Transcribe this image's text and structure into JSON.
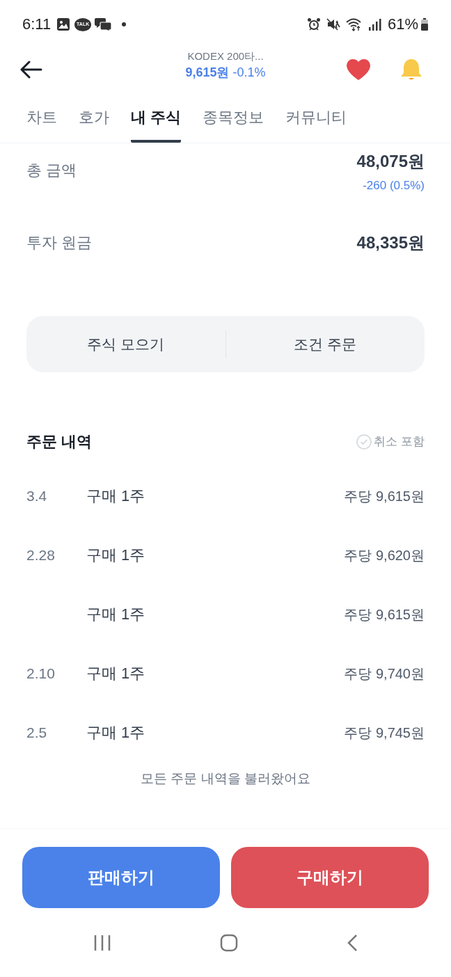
{
  "status_bar": {
    "time": "6:11",
    "chat_badge": "TALK",
    "battery": "61%"
  },
  "header": {
    "title": "KODEX 200타...",
    "price": "9,615원",
    "change": "-0.1%",
    "favorite": true,
    "alert_on": true
  },
  "tabs": [
    {
      "label": "차트",
      "selected": false
    },
    {
      "label": "호가",
      "selected": false
    },
    {
      "label": "내 주식",
      "selected": true
    },
    {
      "label": "종목정보",
      "selected": false
    },
    {
      "label": "커뮤니티",
      "selected": false
    }
  ],
  "summary": [
    {
      "label": "총 금액",
      "value": "48,075원",
      "change": "-260 (0.5%)"
    },
    {
      "label": "투자 원금",
      "value": "48,335원"
    }
  ],
  "actions": [
    "주식 모으기",
    "조건 주문"
  ],
  "orders": {
    "title": "주문 내역",
    "filter": {
      "label": "취소 포함",
      "checked": false
    },
    "rows": [
      {
        "date": "3.4",
        "type": "구매 1주",
        "price": "주당 9,615원"
      },
      {
        "date": "2.28",
        "type": "구매 1주",
        "price": "주당 9,620원"
      },
      {
        "type": "구매 1주",
        "price": "주당 9,615원"
      },
      {
        "date": "2.10",
        "type": "구매 1주",
        "price": "주당 9,740원"
      },
      {
        "date": "2.5",
        "type": "구매 1주",
        "price": "주당 9,745원"
      }
    ],
    "footer": "모든 주문 내역을 불러왔어요"
  },
  "buttons": [
    {
      "label": "판매하기",
      "kind": "sell"
    },
    {
      "label": "구매하기",
      "kind": "buy"
    }
  ]
}
